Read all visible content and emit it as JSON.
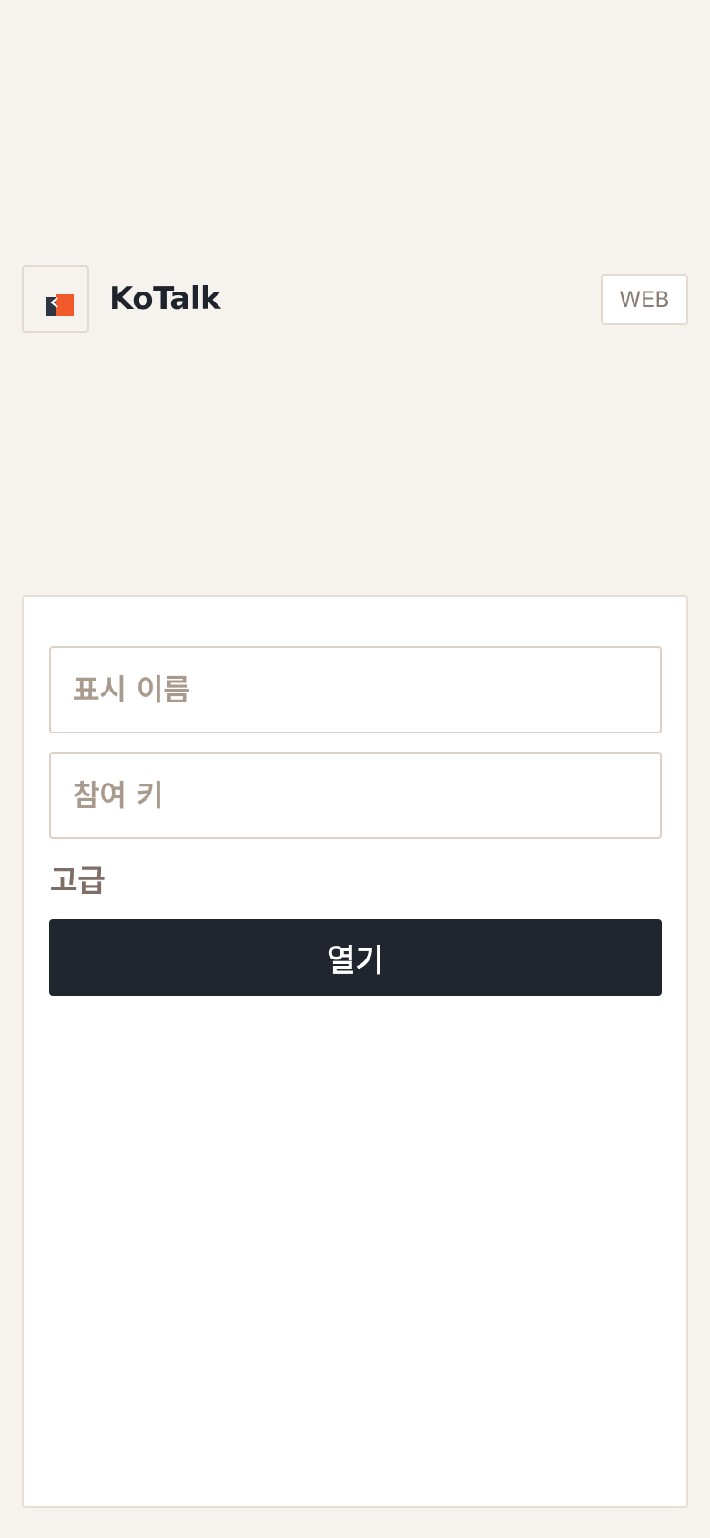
{
  "header": {
    "app_title": "KoTalk",
    "badge": "WEB",
    "logo_icon": "kotalk-logo-icon"
  },
  "form": {
    "display_name": {
      "placeholder": "표시 이름",
      "value": ""
    },
    "join_key": {
      "placeholder": "참여 키",
      "value": ""
    },
    "advanced_label": "고급",
    "open_label": "열기"
  },
  "colors": {
    "background": "#f6f2ed",
    "card": "#ffffff",
    "primary_button": "#21252d",
    "logo_orange": "#f05a2a",
    "logo_dark": "#2e3440",
    "title_text": "#1f232b",
    "muted_text": "#7d6f67",
    "placeholder_text": "#a99a8e",
    "border": "#e3d9cf"
  }
}
